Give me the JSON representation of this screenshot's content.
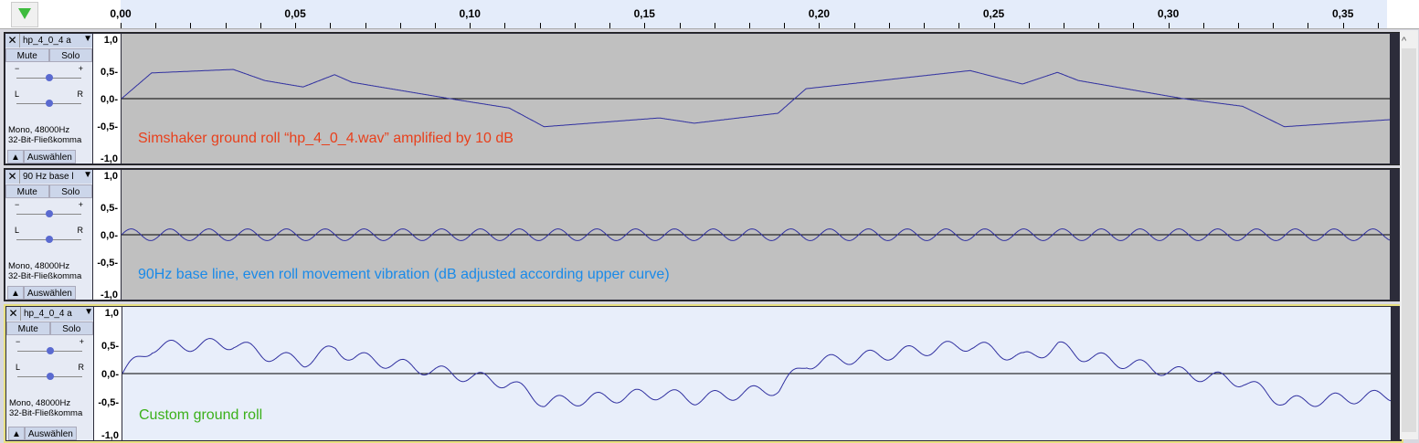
{
  "ruler": {
    "ticks": [
      "0,00",
      "0,05",
      "0,10",
      "0,15",
      "0,20",
      "0,25",
      "0,30",
      "0,35"
    ]
  },
  "scale_labels": [
    "1,0",
    "0,5-",
    "0,0-",
    "-0,5-",
    "-1,0"
  ],
  "buttons": {
    "mute": "Mute",
    "solo": "Solo",
    "select": "Auswählen",
    "close": "✕",
    "menu": "▼",
    "collapse": "▲"
  },
  "gain": {
    "minus": "−",
    "plus": "+",
    "value": 0.5
  },
  "pan": {
    "left": "L",
    "right": "R",
    "value": 0.5
  },
  "tracks": [
    {
      "name": "hp_4_0_4 a",
      "format": "Mono, 48000Hz",
      "bits": "32-Bit-Fließkomma",
      "caption": "Simshaker ground roll “hp_4_0_4.wav” amplified by 10 dB",
      "caption_color": "#e8401c",
      "selected": false,
      "envelope": true,
      "sine_amp": 0
    },
    {
      "name": "90 Hz base l",
      "format": "Mono, 48000Hz",
      "bits": "32-Bit-Fließkomma",
      "caption": "90Hz base line, even roll movement vibration (dB adjusted according upper curve)",
      "caption_color": "#1a8ae8",
      "selected": false,
      "envelope": false,
      "sine_amp": 0.1
    },
    {
      "name": "hp_4_0_4 a",
      "format": "Mono, 48000Hz",
      "bits": "32-Bit-Fließkomma",
      "caption": "Custom ground roll",
      "caption_color": "#3ab01a",
      "selected": true,
      "envelope": true,
      "sine_amp": 0.1
    }
  ],
  "signal": {
    "sine_hz": 90,
    "duration": 0.363,
    "envelope_t": [
      0,
      0.0086,
      0.032,
      0.041,
      0.052,
      0.061,
      0.066,
      0.094,
      0.111,
      0.121,
      0.154,
      0.164,
      0.188,
      0.196,
      0.243,
      0.258,
      0.268,
      0.274,
      0.304,
      0.321,
      0.333,
      0.363
    ],
    "envelope_v": [
      0,
      0.44,
      0.5,
      0.31,
      0.2,
      0.41,
      0.28,
      0,
      -0.16,
      -0.48,
      -0.33,
      -0.42,
      -0.25,
      0.17,
      0.48,
      0.25,
      0.45,
      0.31,
      0,
      -0.13,
      -0.48,
      -0.36
    ]
  },
  "colors": {
    "wave": "#3030a0"
  }
}
